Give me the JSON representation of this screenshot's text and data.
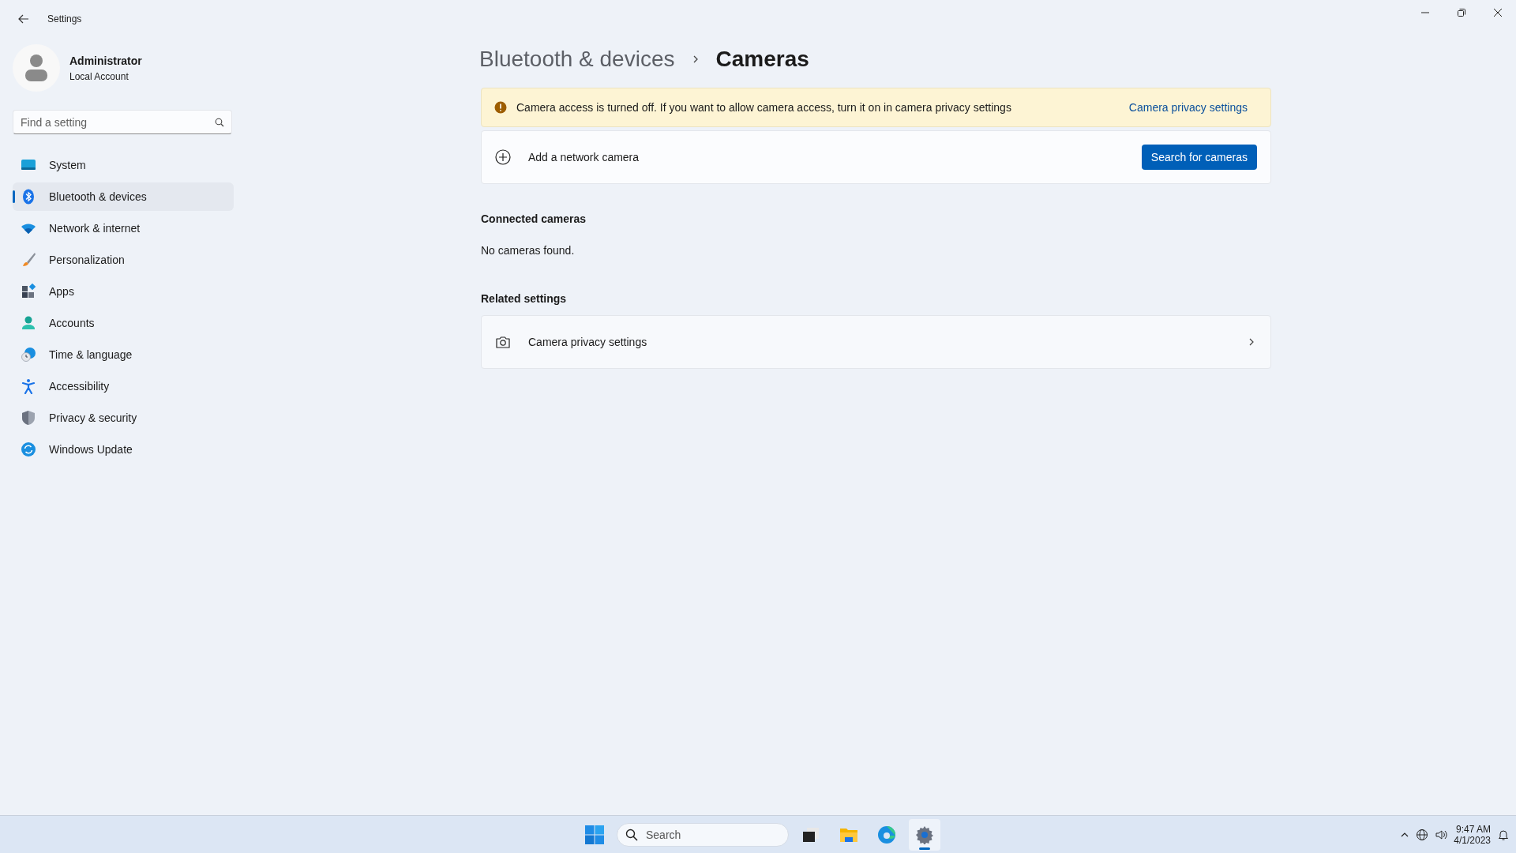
{
  "window": {
    "title": "Settings"
  },
  "user": {
    "name": "Administrator",
    "account": "Local Account"
  },
  "search": {
    "placeholder": "Find a setting"
  },
  "nav": [
    {
      "label": "System",
      "kind": "system",
      "selected": false
    },
    {
      "label": "Bluetooth & devices",
      "kind": "bluetooth",
      "selected": true
    },
    {
      "label": "Network & internet",
      "kind": "network",
      "selected": false
    },
    {
      "label": "Personalization",
      "kind": "brush",
      "selected": false
    },
    {
      "label": "Apps",
      "kind": "apps",
      "selected": false
    },
    {
      "label": "Accounts",
      "kind": "accounts",
      "selected": false
    },
    {
      "label": "Time & language",
      "kind": "time",
      "selected": false
    },
    {
      "label": "Accessibility",
      "kind": "accessibility",
      "selected": false
    },
    {
      "label": "Privacy & security",
      "kind": "privacy",
      "selected": false
    },
    {
      "label": "Windows Update",
      "kind": "update",
      "selected": false
    }
  ],
  "breadcrumb": {
    "parent": "Bluetooth & devices",
    "current": "Cameras"
  },
  "banner": {
    "message": "Camera access is turned off. If you want to allow camera access, turn it on in camera privacy settings",
    "link": "Camera privacy settings"
  },
  "add_camera": {
    "label": "Add a network camera",
    "button": "Search for cameras"
  },
  "connected": {
    "heading": "Connected cameras",
    "empty": "No cameras found."
  },
  "related": {
    "heading": "Related settings",
    "items": [
      {
        "label": "Camera privacy settings"
      }
    ]
  },
  "taskbar": {
    "search_placeholder": "Search",
    "time": "9:47 AM",
    "date": "4/1/2023"
  }
}
